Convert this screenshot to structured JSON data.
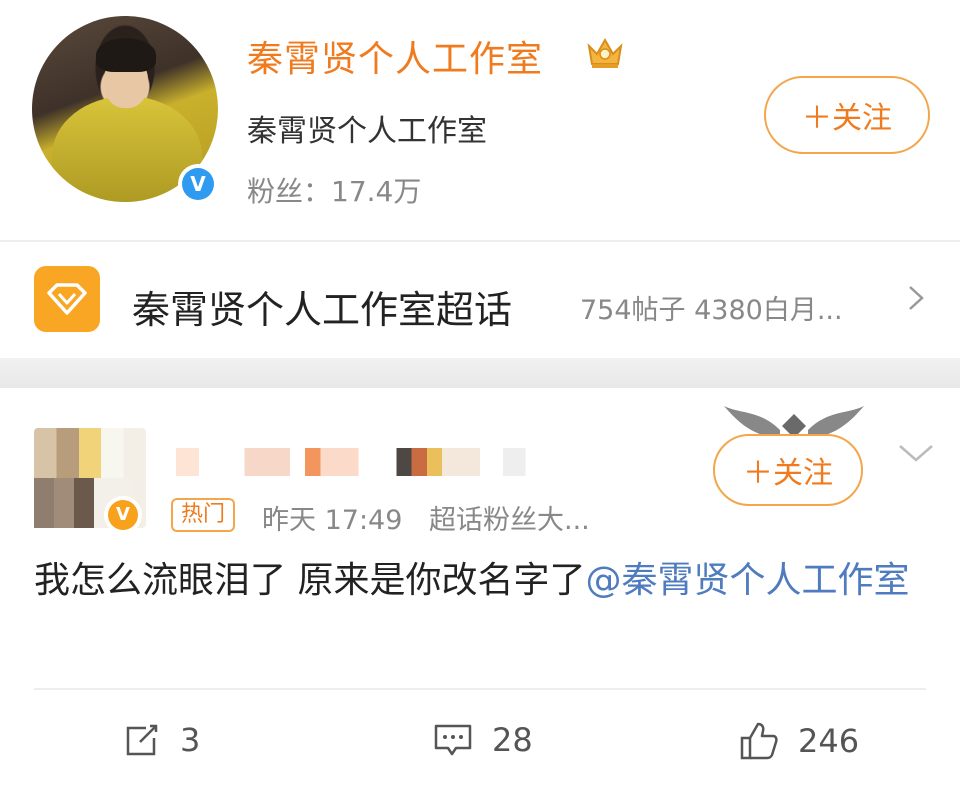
{
  "profile": {
    "name": "秦霄贤个人工作室",
    "subtitle": "秦霄贤个人工作室",
    "fans_label": "粉丝：17.4万",
    "follow_label": "＋关注",
    "verified_icon": "verified-v-icon",
    "crown_icon": "gold-crown-icon"
  },
  "super_topic": {
    "title": "秦霄贤个人工作室超话",
    "meta": "754帖子  4380白月...",
    "icon": "diamond-icon"
  },
  "post": {
    "tag": "热门",
    "time": "昨天 17:49",
    "source": "超话粉丝大...",
    "follow_label": "＋关注",
    "text_before": "我怎么流眼泪了 原来是你改名字了",
    "mention": "@秦霄贤个人工作室",
    "actions": {
      "share": "3",
      "comment": "28",
      "like": "246"
    }
  },
  "colors": {
    "accent_orange": "#f07b1f",
    "mention_blue": "#4f7bbf",
    "verified_blue": "#2f9bf0",
    "verified_orange": "#f7a11c"
  }
}
